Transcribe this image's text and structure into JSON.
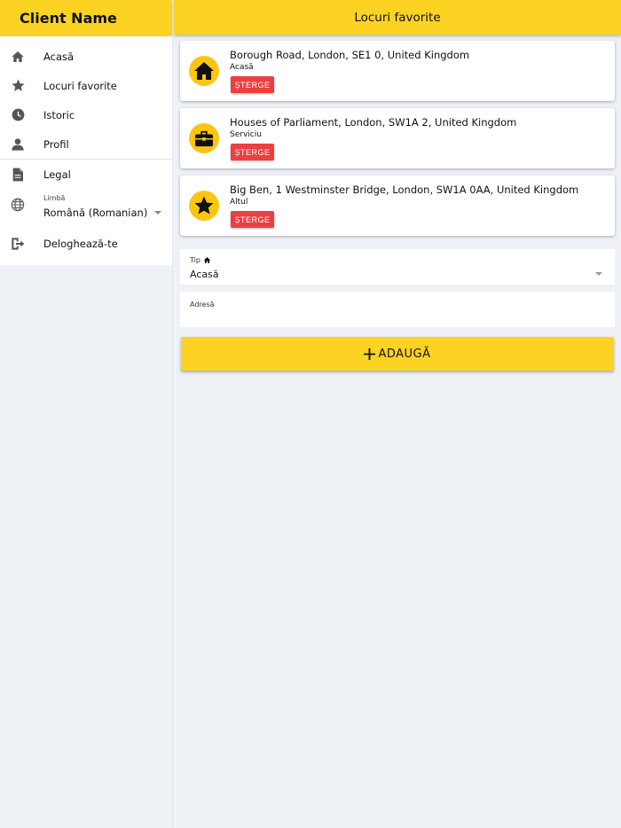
{
  "sidebar": {
    "title": "Client Name",
    "items": [
      {
        "label": "Acasă",
        "icon": "home-icon"
      },
      {
        "label": "Locuri favorite",
        "icon": "star-icon"
      },
      {
        "label": "Istoric",
        "icon": "clock-icon"
      },
      {
        "label": "Profil",
        "icon": "person-icon"
      },
      {
        "label": "Legal",
        "icon": "document-icon"
      }
    ],
    "language": {
      "caption": "Limbă",
      "value": "Română (Romanian)",
      "icon": "globe-icon"
    },
    "logout": {
      "label": "Deloghează-te",
      "icon": "logout-icon"
    }
  },
  "header": {
    "title": "Locuri favorite"
  },
  "favorites": [
    {
      "address": "Borough Road, London, SE1 0, United Kingdom",
      "type": "Acasă",
      "icon": "home-icon",
      "delete_label": "ȘTERGE"
    },
    {
      "address": "Houses of Parliament, London, SW1A 2, United Kingdom",
      "type": "Serviciu",
      "icon": "briefcase-icon",
      "delete_label": "ȘTERGE"
    },
    {
      "address": "Big Ben, 1 Westminster Bridge, London, SW1A 0AA, United Kingdom",
      "type": "Altul",
      "icon": "star-icon",
      "delete_label": "ȘTERGE"
    }
  ],
  "form": {
    "type_caption": "Tip",
    "type_value": "Acasă",
    "address_caption": "Adresă",
    "address_value": "",
    "add_label": "ADAUGĂ"
  },
  "colors": {
    "accent": "#fdd323",
    "icon_circle": "#fdc512",
    "delete": "#ec3f3f",
    "background": "#eef1f6"
  }
}
